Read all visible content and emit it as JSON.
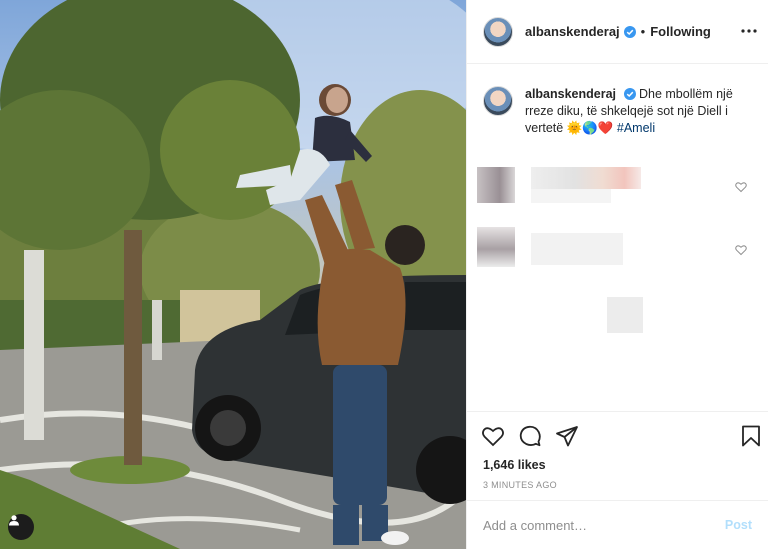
{
  "post": {
    "username": "albanskenderaj",
    "follow_separator": "•",
    "follow_status": "Following",
    "caption_text": "Dhe mbollëm një rreze diku, të shkelqejë sot një Diell i vertetë",
    "caption_emojis": "🌞🌎❤️",
    "caption_hashtag": "#Ameli",
    "likes": "1,646 likes",
    "timestamp": "3 MINUTES AGO",
    "comment_placeholder": "Add a comment…",
    "post_label": "Post"
  },
  "colors": {
    "verified_blue": "#3897f0",
    "hashtag": "#00376b",
    "post_button_disabled": "#b2dffc",
    "timestamp_gray": "#8e8e8e"
  },
  "icons": {
    "heart": "heart-icon",
    "comment": "comment-icon",
    "share": "share-icon",
    "bookmark": "bookmark-icon",
    "more": "more-options-icon",
    "user_tag": "user-tag-icon"
  }
}
